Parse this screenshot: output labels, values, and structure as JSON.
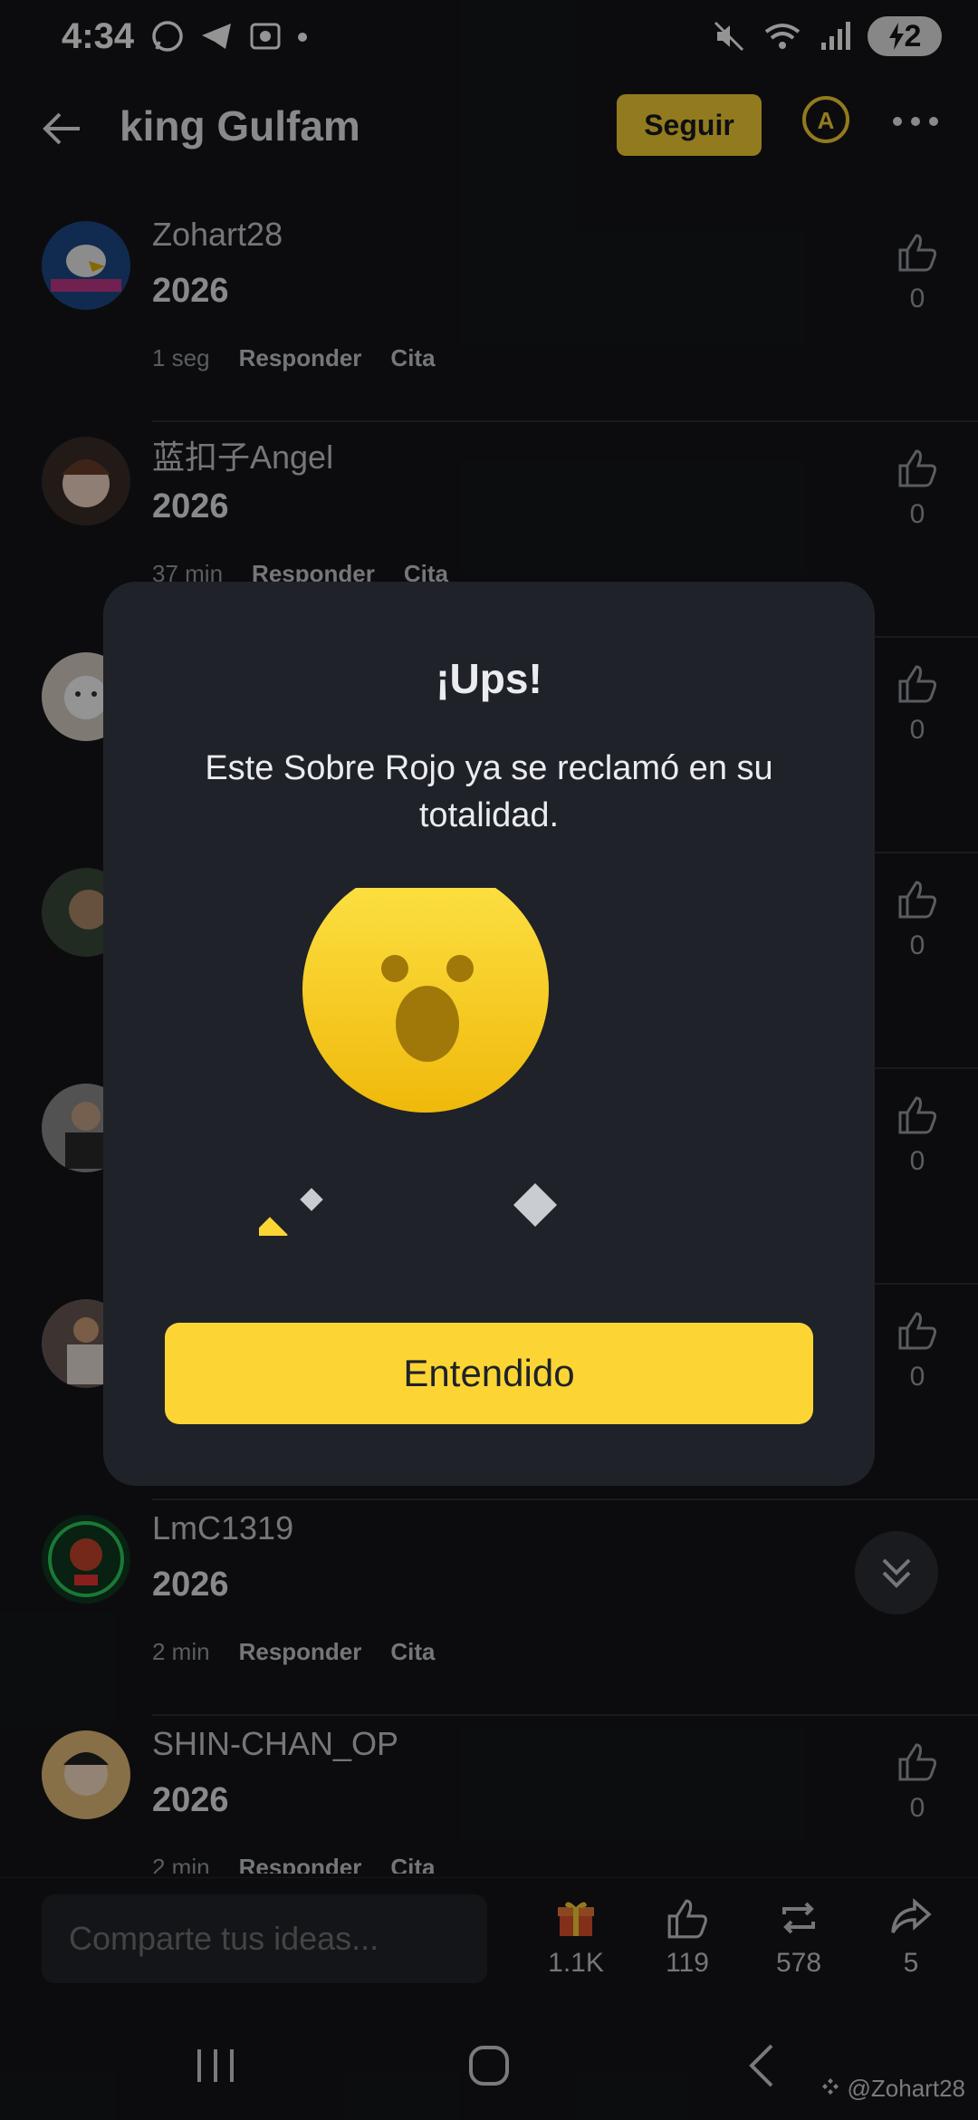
{
  "status_bar": {
    "time": "4:34",
    "battery_level": "2"
  },
  "header": {
    "title": "king Gulfam",
    "follow_label": "Seguir"
  },
  "comments": [
    {
      "username": "Zohart28",
      "content": "2026",
      "time": "1 seg",
      "reply": "Responder",
      "quote": "Cita",
      "likes": "0"
    },
    {
      "username": "蓝扣子Angel",
      "content": "2026",
      "time": "37 min",
      "reply": "Responder",
      "quote": "Cita",
      "likes": "0"
    },
    {
      "username": "",
      "content": "",
      "time": "",
      "reply": "",
      "quote": "",
      "likes": "0"
    },
    {
      "username": "",
      "content": "",
      "time": "",
      "reply": "",
      "quote": "",
      "likes": "0"
    },
    {
      "username": "",
      "content": "",
      "time": "",
      "reply": "",
      "quote": "",
      "likes": "0"
    },
    {
      "username": "",
      "content": "",
      "time": "",
      "reply": "",
      "quote": "",
      "likes": "0"
    },
    {
      "username": "LmC1319",
      "content": "2026",
      "time": "2 min",
      "reply": "Responder",
      "quote": "Cita",
      "likes": ""
    },
    {
      "username": "SHIN-CHAN_OP",
      "content": "2026",
      "time": "2 min",
      "reply": "Responder",
      "quote": "Cita",
      "likes": "0"
    }
  ],
  "bottom_bar": {
    "compose_placeholder": "Comparte tus ideas...",
    "gift_count": "1.1K",
    "like_count": "119",
    "repost_count": "578",
    "share_count": "5"
  },
  "modal": {
    "title": "¡Ups!",
    "message": "Este Sobre Rojo ya se reclamó en su totalidad.",
    "button_label": "Entendido"
  },
  "watermark": "@Zohart28",
  "colors": {
    "accent": "#fcd535",
    "background": "#15161a",
    "modal": "#1f2229"
  }
}
